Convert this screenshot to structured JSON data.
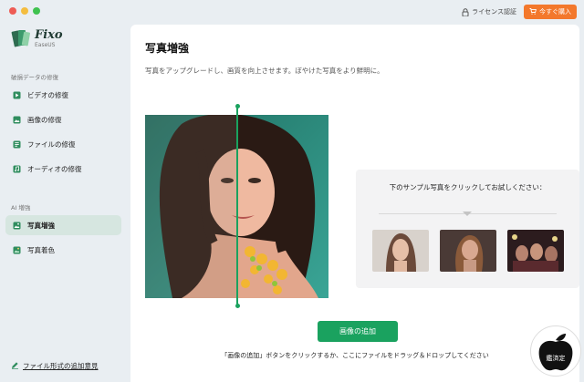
{
  "window": {
    "title": ""
  },
  "topbar": {
    "license_label": "ライセンス認証",
    "buy_label": "今すぐ購入"
  },
  "app": {
    "name": "Fixo",
    "vendor": "EaseUS"
  },
  "sidebar": {
    "section1_label": "破損データの修復",
    "items": [
      {
        "label": "ビデオの修復",
        "icon": "play-icon"
      },
      {
        "label": "画像の修復",
        "icon": "image-icon"
      },
      {
        "label": "ファイルの修復",
        "icon": "file-icon"
      },
      {
        "label": "オーディオの修復",
        "icon": "music-icon"
      }
    ],
    "section2_label": "AI 増強",
    "ai_items": [
      {
        "label": "写真増強",
        "icon": "photo-enhance-icon",
        "active": true
      },
      {
        "label": "写真着色",
        "icon": "photo-colorize-icon",
        "active": false
      }
    ],
    "feedback_label": "ファイル形式の追加意見"
  },
  "main": {
    "title": "写真増強",
    "description": "写真をアップグレードし、画質を向上させます。ぼやけた写真をより鮮明に。",
    "sample_title": "下のサンプル写真をクリックしてお試しください：",
    "add_button": "画像の追加",
    "drop_hint": "「画像の追加」ボタンをクリックするか、ここにファイルをドラッグ＆ドロップしてください"
  },
  "stamp": {
    "text": "鑑済定"
  },
  "colors": {
    "accent_green": "#1aa25f",
    "buy_orange": "#f3782c",
    "sidebar_active": "#d6e6e0"
  }
}
